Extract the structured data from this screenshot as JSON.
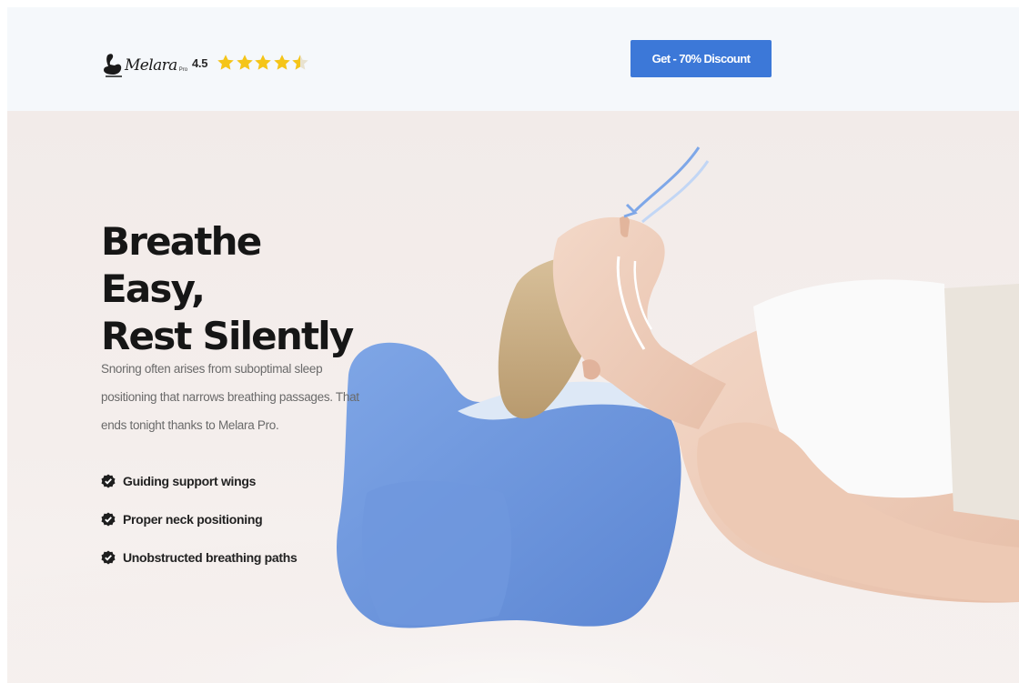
{
  "header": {
    "logo": {
      "icon": "swan-logo-icon",
      "name": "Melara",
      "suffix": "Pro"
    },
    "rating": {
      "value": "4.5",
      "score": 4.5,
      "max": 5,
      "star_color": "#f5c518"
    },
    "cta_label": "Get - 70% Discount",
    "cta_color": "#3c78d8"
  },
  "hero": {
    "title_line1": "Breathe Easy,",
    "title_line2": "Rest Silently",
    "description": "Snoring often arises from suboptimal sleep positioning that narrows breathing passages. That ends tonight thanks to Melara Pro.",
    "features": [
      {
        "icon": "check-badge-icon",
        "label": "Guiding support wings"
      },
      {
        "icon": "check-badge-icon",
        "label": "Proper neck positioning"
      },
      {
        "icon": "check-badge-icon",
        "label": "Unobstructed breathing paths"
      }
    ],
    "image": "woman-sleeping-on-blue-contour-pillow"
  }
}
